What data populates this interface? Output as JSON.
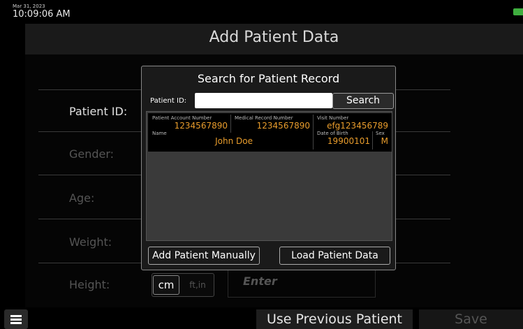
{
  "status": {
    "date": "Mar 31, 2023",
    "time": "10:09:06 AM",
    "battery_color": "#3fae3f"
  },
  "header": {
    "title": "Add Patient Data"
  },
  "form": {
    "labels": {
      "patient_id": "Patient ID:",
      "gender": "Gender:",
      "age": "Age:",
      "weight": "Weight:",
      "height": "Height:"
    },
    "height_units": {
      "selected": "cm",
      "other": "ft,in"
    },
    "height_placeholder": "Enter"
  },
  "footer": {
    "menu_icon": "hamburger-menu-icon",
    "use_previous": "Use Previous Patient",
    "save": "Save"
  },
  "modal": {
    "title": "Search for Patient Record",
    "patient_id_label": "Patient ID:",
    "patient_id_value": "",
    "search_label": "Search",
    "add_manually_label": "Add Patient Manually",
    "load_label": "Load Patient Data",
    "result_columns": {
      "account": "Patient Account Number",
      "mrn": "Medical Record Number",
      "visit": "Visit Number",
      "name": "Name",
      "dob": "Date of Birth",
      "sex": "Sex"
    },
    "results": [
      {
        "account": "1234567890",
        "mrn": "1234567890",
        "visit": "efg123456789",
        "name": "John Doe",
        "dob": "19900101",
        "sex": "M"
      }
    ],
    "value_color": "#e89c2c"
  }
}
